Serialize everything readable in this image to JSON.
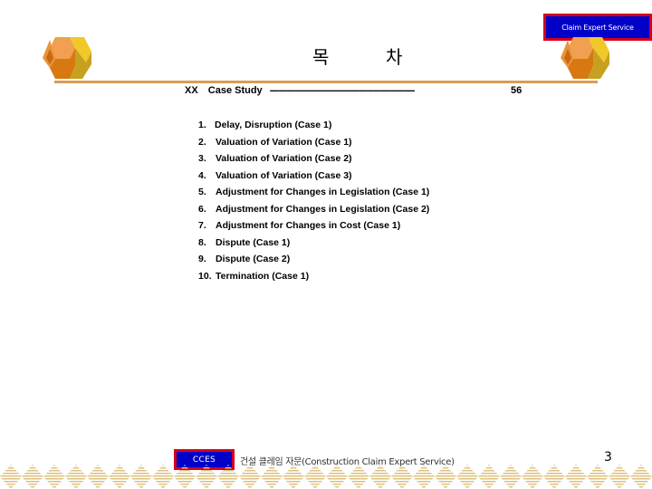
{
  "header": {
    "brand_badge": "Claim Expert Service",
    "title_part1": "목",
    "title_part2": "차"
  },
  "toc": {
    "section_label": "XX",
    "section_title": "Case Study",
    "leader": "------------------------------------------------------------",
    "page": "56",
    "items": [
      {
        "num": "1.",
        "label": "Delay, Disruption (Case 1)"
      },
      {
        "num": "2.",
        "label": "Valuation of Variation (Case 1)"
      },
      {
        "num": "3.",
        "label": "Valuation of Variation (Case 2)"
      },
      {
        "num": "4.",
        "label": "Valuation of Variation (Case 3)"
      },
      {
        "num": "5.",
        "label": "Adjustment for Changes in Legislation (Case 1)"
      },
      {
        "num": "6.",
        "label": "Adjustment for Changes in Legislation (Case 2)"
      },
      {
        "num": "7.",
        "label": "Adjustment for Changes in Cost (Case 1)"
      },
      {
        "num": "8.",
        "label": "Dispute (Case 1)"
      },
      {
        "num": "9.",
        "label": "Dispute (Case 2)"
      },
      {
        "num": "10.",
        "label": "Termination (Case 1)"
      }
    ]
  },
  "footer": {
    "badge": "CCES",
    "text": "건설 클레임 자문(Construction Claim Expert Service)",
    "page_number": "3"
  },
  "colors": {
    "badge_fill": "#0000c8",
    "badge_border": "#d4001c",
    "accent_line": "#d89c58",
    "cube_orange": "#e8943a",
    "cube_yellow": "#e8c020",
    "diamond_stripe": "#dcc080"
  }
}
